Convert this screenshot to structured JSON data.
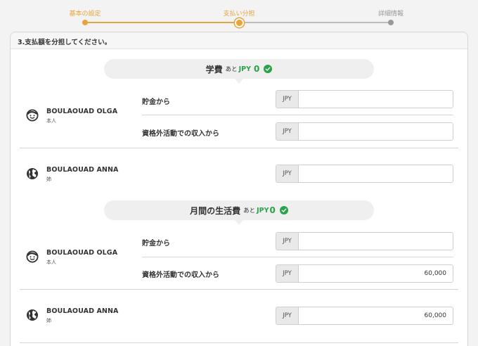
{
  "stepper": {
    "steps": [
      {
        "label": "基本の設定",
        "state": "done"
      },
      {
        "label": "支払い分担",
        "state": "active"
      },
      {
        "label": "詳細情報",
        "state": "todo"
      }
    ]
  },
  "panel": {
    "title": "3.支払額を分担してください。"
  },
  "sections": [
    {
      "title": "学費",
      "remaining_prefix": "あと",
      "remaining_currency": "JPY",
      "remaining_amount": "0",
      "payers": [
        {
          "name": "BOULAOUAD OLGA",
          "relation": "本人",
          "icon": "smiley-face-icon",
          "sources": [
            {
              "label": "貯金から",
              "currency": "JPY",
              "value": "",
              "placeholder": ""
            },
            {
              "label": "資格外活動での収入から",
              "currency": "JPY",
              "value": "",
              "placeholder": ""
            }
          ]
        },
        {
          "name": "BOULAOUAD ANNA",
          "relation": "姉",
          "icon": "globe-icon",
          "sources": [
            {
              "label": "",
              "currency": "JPY",
              "value": "",
              "placeholder": ""
            }
          ]
        }
      ]
    },
    {
      "title": "月間の生活費",
      "remaining_prefix": "あと",
      "remaining_currency": "JPY",
      "remaining_amount": "0",
      "payers": [
        {
          "name": "BOULAOUAD OLGA",
          "relation": "本人",
          "icon": "smiley-face-icon",
          "sources": [
            {
              "label": "貯金から",
              "currency": "JPY",
              "value": "",
              "placeholder": ""
            },
            {
              "label": "資格外活動での収入から",
              "currency": "JPY",
              "value": "60,000",
              "placeholder": ""
            }
          ]
        },
        {
          "name": "BOULAOUAD ANNA",
          "relation": "姉",
          "icon": "globe-icon",
          "sources": [
            {
              "label": "",
              "currency": "JPY",
              "value": "60,000",
              "placeholder": ""
            }
          ]
        }
      ]
    }
  ],
  "colors": {
    "accent": "#e8a33a",
    "success": "#29a34a",
    "muted": "#bbbbbb"
  }
}
